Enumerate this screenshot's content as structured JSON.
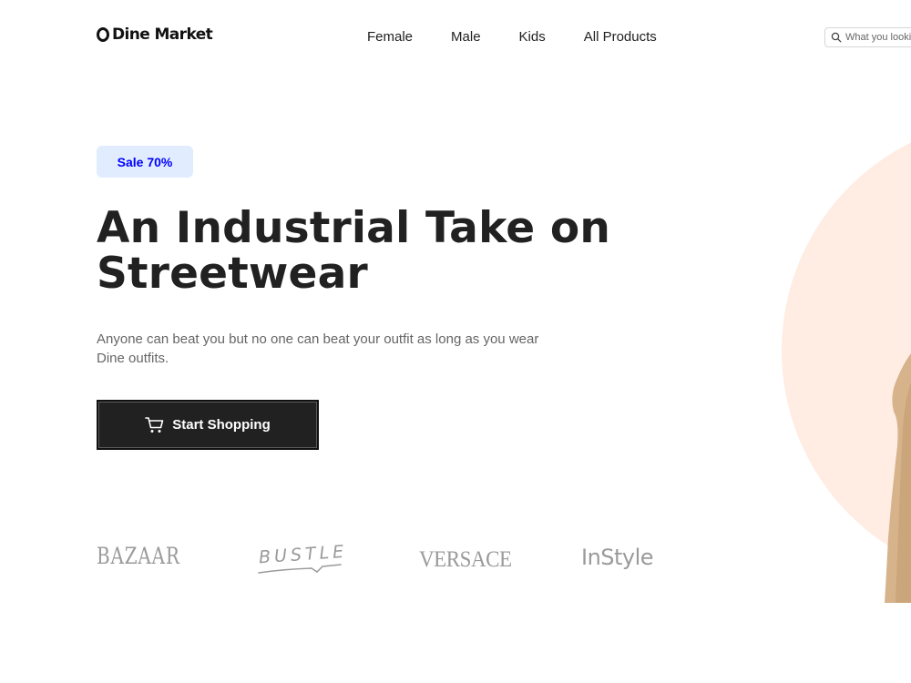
{
  "header": {
    "brand_name": "Dine Market",
    "nav": [
      {
        "label": "Female"
      },
      {
        "label": "Male"
      },
      {
        "label": "Kids"
      },
      {
        "label": "All Products"
      }
    ],
    "search": {
      "placeholder": "What you looking for",
      "icon": "search-icon"
    }
  },
  "hero": {
    "badge": "Sale 70%",
    "title": "An Industrial Take on Streetwear",
    "description": "Anyone can beat you but no one can beat your outfit as long as you wear Dine outfits.",
    "cta_label": "Start Shopping",
    "cta_icon": "cart-icon"
  },
  "brands": [
    {
      "name": "BAZAAR"
    },
    {
      "name": "BUSTLE"
    },
    {
      "name": "VERSACE"
    },
    {
      "name": "InStyle"
    }
  ],
  "colors": {
    "accent_badge_bg": "#e1edff",
    "accent_badge_text": "#0000ff",
    "primary_dark": "#212121",
    "hero_circle": "#ffece3",
    "brand_logo_gray": "#9a9a9a"
  }
}
